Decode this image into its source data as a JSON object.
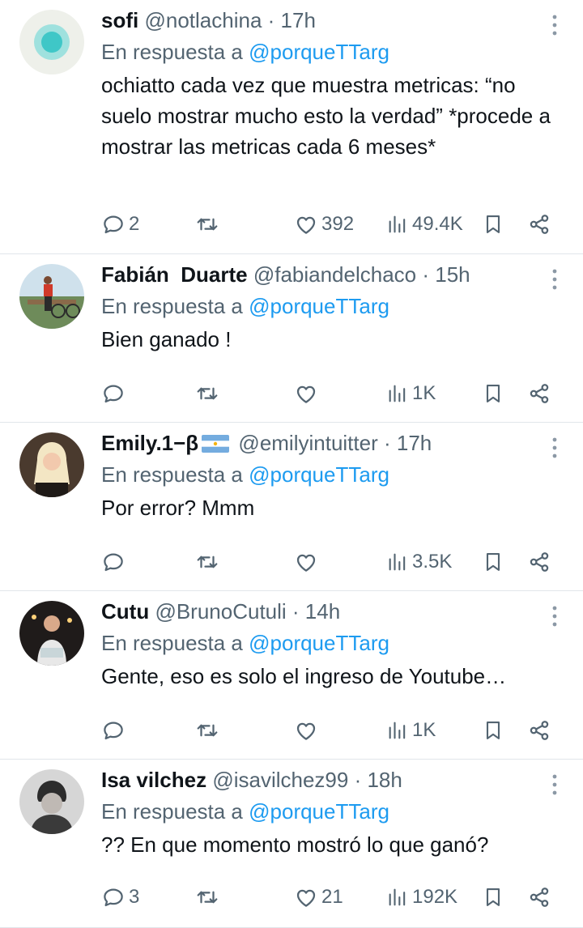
{
  "colors": {
    "link": "#1d9bf0",
    "muted": "#536471",
    "text": "#0f1419",
    "divider": "#e1e6ea"
  },
  "tweets": [
    {
      "name": "sofi",
      "handle": "@notlachina",
      "time": "· 17h",
      "reply_prefix": "En respuesta a",
      "reply_to": "@porqueTTarg",
      "text": "ochiatto cada vez que muestra metricas: “no suelo mostrar mucho esto la verdad” *procede a mostrar las metricas cada 6 meses*",
      "replies": "2",
      "retweets": "",
      "likes": "392",
      "views": "49.4K"
    },
    {
      "name": "Fabián  Duarte",
      "handle": "@fabiandelchaco",
      "time": "· 15h",
      "reply_prefix": "En respuesta a",
      "reply_to": "@porqueTTarg",
      "text": "Bien ganado !",
      "replies": "",
      "retweets": "",
      "likes": "",
      "views": "1K"
    },
    {
      "name": "Emily.1−β",
      "handle": "@emilyintuitter",
      "time": "· 17h",
      "reply_prefix": "En respuesta a",
      "reply_to": "@porqueTTarg",
      "text": "Por error? Mmm",
      "replies": "",
      "retweets": "",
      "likes": "",
      "views": "3.5K"
    },
    {
      "name": "Cutu",
      "handle": "@BrunoCutuli",
      "time": "· 14h",
      "reply_prefix": "En respuesta a",
      "reply_to": "@porqueTTarg",
      "text": "Gente, eso es solo el ingreso de Youtube…",
      "replies": "",
      "retweets": "",
      "likes": "",
      "views": "1K"
    },
    {
      "name": "Isa vilchez",
      "handle": "@isavilchez99",
      "time": "· 18h",
      "reply_prefix": "En respuesta a",
      "reply_to": "@porqueTTarg",
      "text": "?? En que momento mostró lo que ganó?",
      "replies": "3",
      "retweets": "",
      "likes": "21",
      "views": "192K"
    }
  ]
}
